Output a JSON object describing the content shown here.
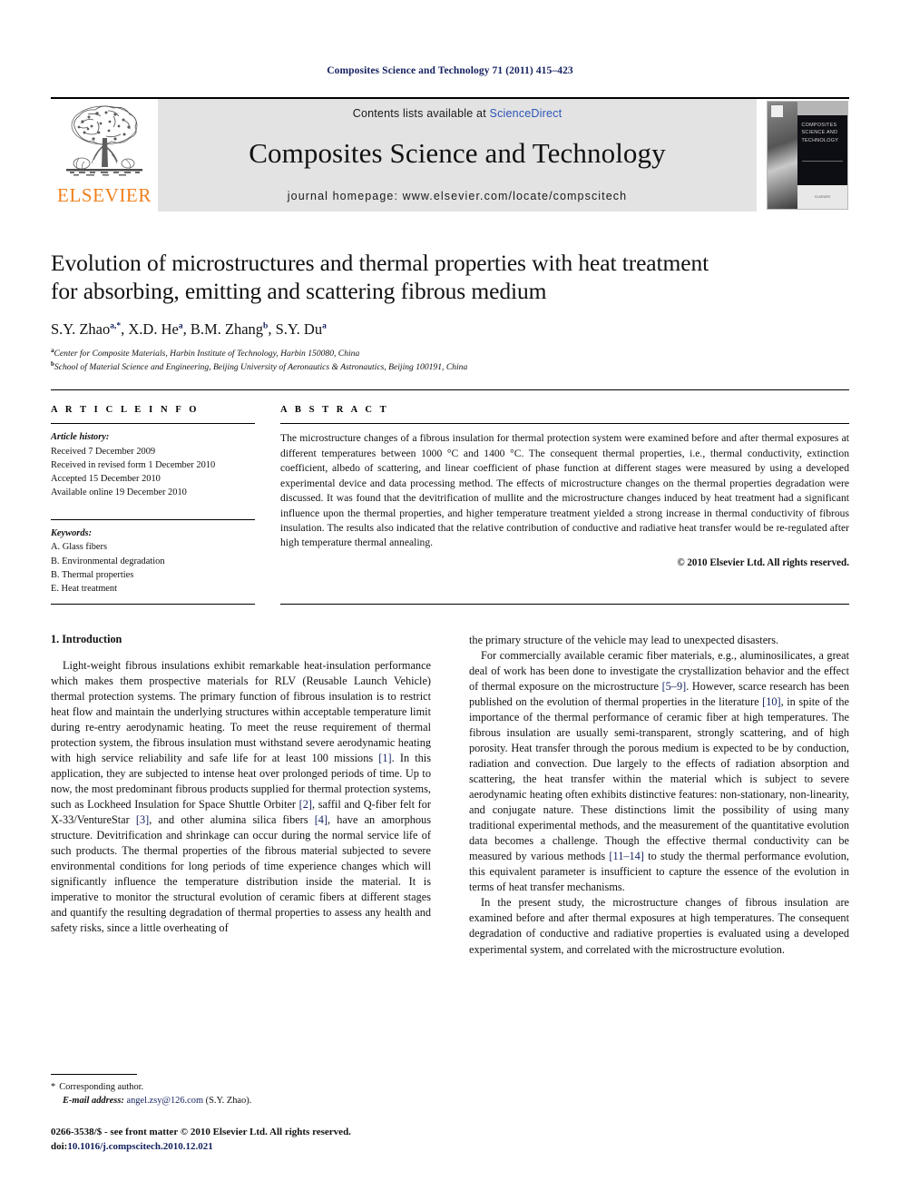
{
  "running_head": "Composites Science and Technology 71 (2011) 415–423",
  "journal_banner": {
    "contents_prefix": "Contents lists available at ",
    "sciencedirect_link": "ScienceDirect",
    "journal_title": "Composites Science and Technology",
    "homepage": "journal homepage: www.elsevier.com/locate/compscitech",
    "publisher_wordmark": "ELSEVIER",
    "cover_title_line1": "COMPOSITES",
    "cover_title_line2": "SCIENCE AND",
    "cover_title_line3": "TECHNOLOGY",
    "cover_footer": "ELSEVIER",
    "colors": {
      "elsevier_orange": "#f07f1a",
      "link_blue": "#2b54b7",
      "banner_grey": "#e3e3e3",
      "running_head_navy": "#13205e"
    }
  },
  "article": {
    "title_line1": "Evolution of microstructures and thermal properties with heat treatment",
    "title_line2": "for absorbing, emitting and scattering fibrous medium",
    "authors": [
      {
        "name": "S.Y. Zhao",
        "sup": "a,*"
      },
      {
        "name": "X.D. He",
        "sup": "a"
      },
      {
        "name": "B.M. Zhang",
        "sup": "b"
      },
      {
        "name": "S.Y. Du",
        "sup": "a"
      }
    ],
    "affiliations": [
      {
        "sup": "a",
        "text": "Center for Composite Materials, Harbin Institute of Technology, Harbin 150080, China"
      },
      {
        "sup": "b",
        "text": "School of Material Science and Engineering, Beijing University of Aeronautics & Astronautics, Beijing 100191, China"
      }
    ]
  },
  "article_info": {
    "heading": "A R T I C L E   I N F O",
    "history_label": "Article history:",
    "history": [
      "Received 7 December 2009",
      "Received in revised form 1 December 2010",
      "Accepted 15 December 2010",
      "Available online 19 December 2010"
    ],
    "keywords_label": "Keywords:",
    "keywords": [
      "A. Glass fibers",
      "B. Environmental degradation",
      "B. Thermal properties",
      "E. Heat treatment"
    ]
  },
  "abstract": {
    "heading": "A B S T R A C T",
    "text": "The microstructure changes of a fibrous insulation for thermal protection system were examined before and after thermal exposures at different temperatures between 1000 °C and 1400 °C. The consequent thermal properties, i.e., thermal conductivity, extinction coefficient, albedo of scattering, and linear coefficient of phase function at different stages were measured by using a developed experimental device and data processing method. The effects of microstructure changes on the thermal properties degradation were discussed. It was found that the devitrification of mullite and the microstructure changes induced by heat treatment had a significant influence upon the thermal properties, and higher temperature treatment yielded a strong increase in thermal conductivity of fibrous insulation. The results also indicated that the relative contribution of conductive and radiative heat transfer would be re-regulated after high temperature thermal annealing.",
    "copyright": "© 2010 Elsevier Ltd. All rights reserved."
  },
  "introduction": {
    "section_title": "1. Introduction",
    "left_paragraphs": [
      "Light-weight fibrous insulations exhibit remarkable heat-insulation performance which makes them prospective materials for RLV (Reusable Launch Vehicle) thermal protection systems. The primary function of fibrous insulation is to restrict heat flow and maintain the underlying structures within acceptable temperature limit during re-entry aerodynamic heating. To meet the reuse requirement of thermal protection system, the fibrous insulation must withstand severe aerodynamic heating with high service reliability and safe life for at least 100 missions [1]. In this application, they are subjected to intense heat over prolonged periods of time. Up to now, the most predominant fibrous products supplied for thermal protection systems, such as Lockheed Insulation for Space Shuttle Orbiter [2], saffil and Q-fiber felt for X-33/VentureStar [3], and other alumina silica fibers [4], have an amorphous structure. Devitrification and shrinkage can occur during the normal service life of such products. The thermal properties of the fibrous material subjected to severe environmental conditions for long periods of time experience changes which will significantly influence the temperature distribution inside the material. It is imperative to monitor the structural evolution of ceramic fibers at different stages and quantify the resulting degradation of thermal properties to assess any health and safety risks, since a little overheating of"
    ],
    "right_paragraphs": [
      "the primary structure of the vehicle may lead to unexpected disasters.",
      "For commercially available ceramic fiber materials, e.g., aluminosilicates, a great deal of work has been done to investigate the crystallization behavior and the effect of thermal exposure on the microstructure [5–9]. However, scarce research has been published on the evolution of thermal properties in the literature [10], in spite of the importance of the thermal performance of ceramic fiber at high temperatures. The fibrous insulation are usually semi-transparent, strongly scattering, and of high porosity. Heat transfer through the porous medium is expected to be by conduction, radiation and convection. Due largely to the effects of radiation absorption and scattering, the heat transfer within the material which is subject to severe aerodynamic heating often exhibits distinctive features: non-stationary, non-linearity, and conjugate nature. These distinctions limit the possibility of using many traditional experimental methods, and the measurement of the quantitative evolution data becomes a challenge. Though the effective thermal conductivity can be measured by various methods [11–14] to study the thermal performance evolution, this equivalent parameter is insufficient to capture the essence of the evolution in terms of heat transfer mechanisms.",
      "In the present study, the microstructure changes of fibrous insulation are examined before and after thermal exposures at high temperatures. The consequent degradation of conductive and radiative properties is evaluated using a developed experimental system, and correlated with the microstructure evolution."
    ]
  },
  "footnote": {
    "corresponding": "Corresponding author.",
    "email_label": "E-mail address:",
    "email": "angel.zsy@126.com",
    "email_suffix": "(S.Y. Zhao)."
  },
  "page_footer": {
    "issn_line": "0266-3538/$ - see front matter © 2010 Elsevier Ltd. All rights reserved.",
    "doi_prefix": "doi:",
    "doi": "10.1016/j.compscitech.2010.12.021"
  }
}
